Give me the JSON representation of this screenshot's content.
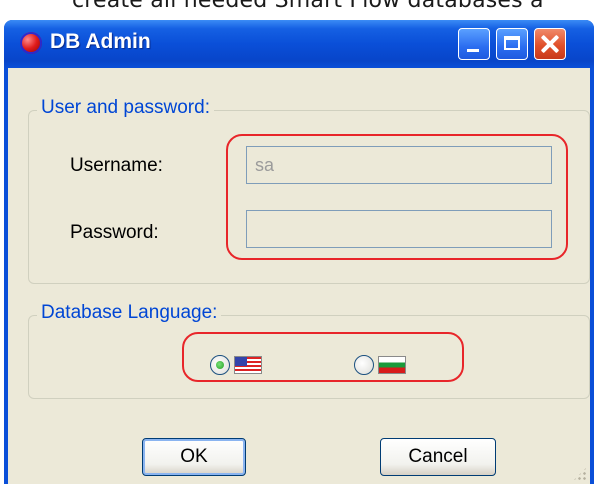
{
  "background_text": "create all needed Smart Flow databases a",
  "window": {
    "title": "DB Admin",
    "controls": {
      "minimize": "minimize",
      "maximize": "maximize",
      "close": "close"
    }
  },
  "credentials": {
    "legend": "User and password:",
    "username_label": "Username:",
    "username_value": "sa",
    "password_label": "Password:",
    "password_value": ""
  },
  "language": {
    "legend": "Database Language:",
    "options": [
      {
        "flag": "us-flag-icon",
        "selected": true
      },
      {
        "flag": "bulgaria-flag-icon",
        "selected": false
      }
    ]
  },
  "buttons": {
    "ok": "OK",
    "cancel": "Cancel"
  },
  "colors": {
    "title_blue": "#0a4fd8",
    "legend_blue": "#0046d5",
    "highlight_red": "#e8262a",
    "client_bg": "#ece9d8"
  }
}
